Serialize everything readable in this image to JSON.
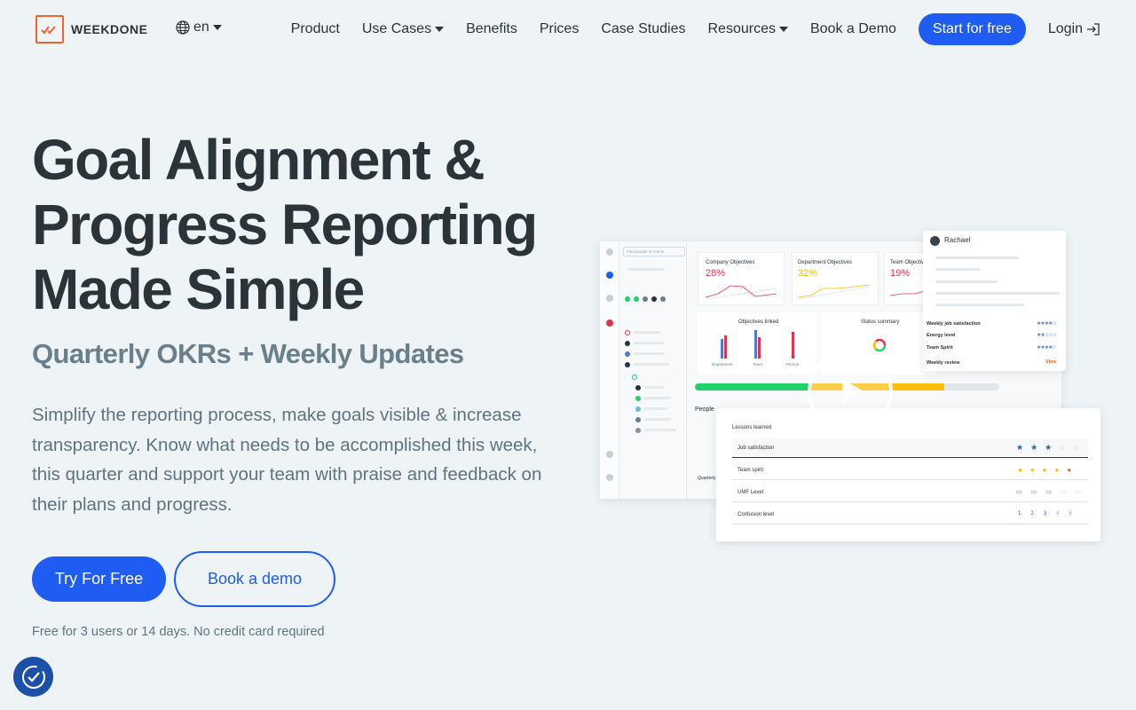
{
  "nav": {
    "logo_text": "WEEKDONE",
    "lang": "en",
    "items": [
      {
        "label": "Product",
        "dropdown": false
      },
      {
        "label": "Use Cases",
        "dropdown": true
      },
      {
        "label": "Benefits",
        "dropdown": false
      },
      {
        "label": "Prices",
        "dropdown": false
      },
      {
        "label": "Case Studies",
        "dropdown": false
      },
      {
        "label": "Resources",
        "dropdown": true
      },
      {
        "label": "Book a Demo",
        "dropdown": false
      }
    ],
    "start_label": "Start for free",
    "login_label": "Login"
  },
  "hero": {
    "title_line1": "Goal Alignment &",
    "title_line2": "Progress Reporting",
    "title_line3": "Made Simple",
    "subtitle": "Quarterly OKRs + Weekly Updates",
    "description": "Simplify the reporting process, make goals visible & increase transparency. Know what needs to be accomplished this week, this quarter and support your team with praise and feedback on their plans and progress.",
    "cta_primary": "Try For Free",
    "cta_secondary": "Book a demo",
    "note": "Free for 3 users or 14 days. No credit card required"
  },
  "mockup": {
    "search_placeholder": "Find people or teams",
    "company_obj_label": "Company Objectives",
    "company_obj_value": "28%",
    "dept_obj_label": "Department Objectives",
    "dept_obj_value": "32%",
    "team_obj_label": "Team Objectives",
    "team_obj_value": "19%",
    "objectives_linked": "Objectives linked",
    "status_summary": "Status summary",
    "bar_labels": [
      "Department",
      "Team",
      "Person"
    ],
    "people_label": "People",
    "quarterly_label": "Quarterly",
    "rachael_name": "Rachael",
    "rachael_rows": [
      "Weekly job satisfaction",
      "Energy level",
      "Team Spirit",
      "Weekly review"
    ],
    "view_label": "View",
    "lessons_title": "Lessons learned",
    "lessons_rows": [
      "Job satisfaction",
      "Team spirit",
      "UMF Level",
      "Confusion level"
    ],
    "scale_values": [
      "1",
      "2",
      "3",
      "4",
      "5"
    ],
    "progress": {
      "green": 0.38,
      "yellow": 0.44
    },
    "colors": {
      "accent": "#1f5cf2",
      "green": "#1fd36a",
      "yellow": "#fbbd08",
      "red": "#e5334b",
      "orange": "#f0642d"
    }
  }
}
